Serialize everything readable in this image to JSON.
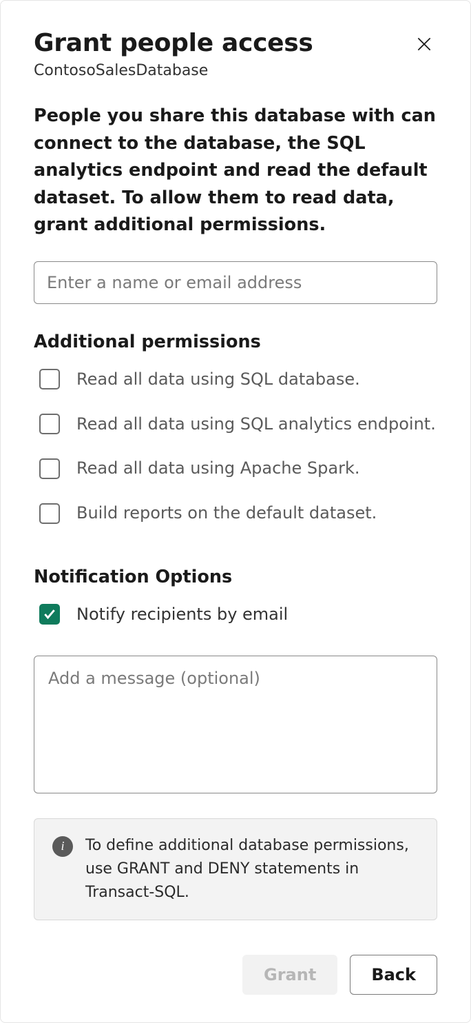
{
  "header": {
    "title": "Grant people access",
    "subtitle": "ContosoSalesDatabase"
  },
  "description": "People you share this database with can connect to the database, the SQL analytics endpoint and read the default dataset. To allow them to read data, grant additional permissions.",
  "name_input": {
    "placeholder": "Enter a name or email address",
    "value": ""
  },
  "permissions": {
    "heading": "Additional permissions",
    "items": [
      {
        "label": "Read all data using SQL database.",
        "checked": false
      },
      {
        "label": "Read all data using SQL analytics endpoint.",
        "checked": false
      },
      {
        "label": "Read all data using Apache Spark.",
        "checked": false
      },
      {
        "label": "Build reports on the default dataset.",
        "checked": false
      }
    ]
  },
  "notification": {
    "heading": "Notification Options",
    "notify_label": "Notify recipients by email",
    "notify_checked": true,
    "message_placeholder": "Add a message (optional)",
    "message_value": ""
  },
  "info_banner": "To define additional database permissions, use GRANT and DENY statements in Transact-SQL.",
  "footer": {
    "primary_label": "Grant",
    "secondary_label": "Back"
  }
}
